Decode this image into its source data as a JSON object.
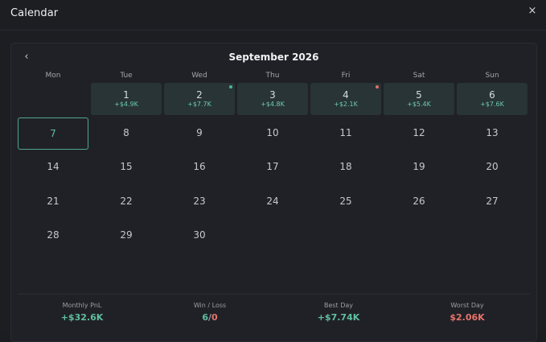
{
  "dialog": {
    "title": "Calendar",
    "close_label": "×"
  },
  "calendar": {
    "prev_label": "‹",
    "month_label": "September 2026",
    "weekdays": [
      "Mon",
      "Tue",
      "Wed",
      "Thu",
      "Fri",
      "Sat",
      "Sun"
    ],
    "today": 7,
    "days": [
      {
        "day": "1",
        "pnl": "+$4.9K"
      },
      {
        "day": "2",
        "pnl": "+$7.7K",
        "dot": "#4fb592"
      },
      {
        "day": "3",
        "pnl": "+$4.8K"
      },
      {
        "day": "4",
        "pnl": "+$2.1K",
        "dot": "#e0716b"
      },
      {
        "day": "5",
        "pnl": "+$5.4K"
      },
      {
        "day": "6",
        "pnl": "+$7.6K"
      },
      {
        "day": "7"
      },
      {
        "day": "8"
      },
      {
        "day": "9"
      },
      {
        "day": "10"
      },
      {
        "day": "11"
      },
      {
        "day": "12"
      },
      {
        "day": "13"
      },
      {
        "day": "14"
      },
      {
        "day": "15"
      },
      {
        "day": "16"
      },
      {
        "day": "17"
      },
      {
        "day": "18"
      },
      {
        "day": "19"
      },
      {
        "day": "20"
      },
      {
        "day": "21"
      },
      {
        "day": "22"
      },
      {
        "day": "23"
      },
      {
        "day": "24"
      },
      {
        "day": "25"
      },
      {
        "day": "26"
      },
      {
        "day": "27"
      },
      {
        "day": "28"
      },
      {
        "day": "29"
      },
      {
        "day": "30"
      }
    ],
    "first_weekday_index": 1
  },
  "summary": {
    "monthly_pnl": {
      "label": "Monthly PnL",
      "value": "+$32.6K"
    },
    "win_loss": {
      "label": "Win / Loss",
      "wins": "6",
      "separator": "/",
      "losses": "0"
    },
    "best_day": {
      "label": "Best Day",
      "value": "+$7.74K"
    },
    "worst_day": {
      "label": "Worst Day",
      "value": "$2.06K"
    }
  },
  "colors": {
    "positive": "#5fbf9f",
    "negative": "#e8736b",
    "pnl_cell": "#283436"
  }
}
